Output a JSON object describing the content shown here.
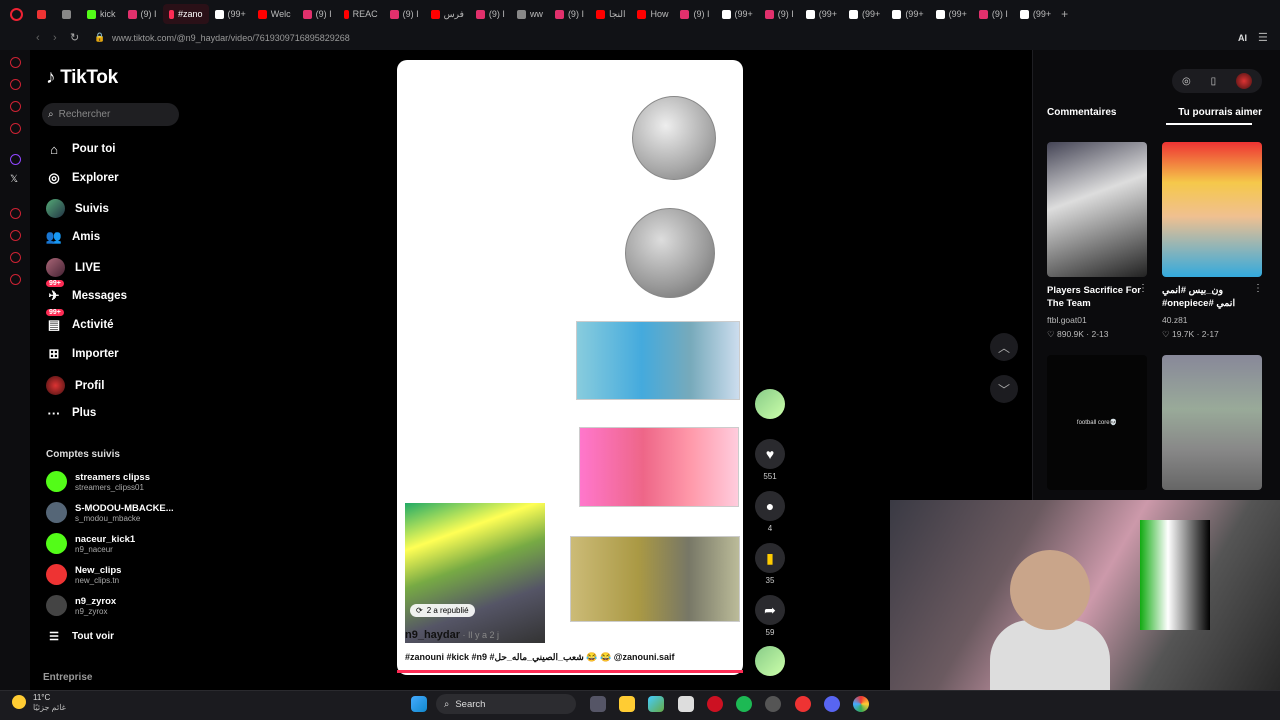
{
  "browser": {
    "tabs": [
      {
        "label": "",
        "color": "#e33"
      },
      {
        "label": "",
        "color": "#888"
      },
      {
        "label": "kick",
        "color": "#53fc18"
      },
      {
        "label": "(9) I",
        "color": "#e1306c"
      },
      {
        "label": "#zano",
        "color": "#fe2c55",
        "active": true
      },
      {
        "label": "(99+",
        "color": "#fff"
      },
      {
        "label": "Welc",
        "color": "#f00"
      },
      {
        "label": "(9) I",
        "color": "#e1306c"
      },
      {
        "label": "REAC",
        "color": "#f00"
      },
      {
        "label": "(9) I",
        "color": "#e1306c"
      },
      {
        "label": "فرس",
        "color": "#f00"
      },
      {
        "label": "(9) I",
        "color": "#e1306c"
      },
      {
        "label": "ww",
        "color": "#888"
      },
      {
        "label": "(9) I",
        "color": "#e1306c"
      },
      {
        "label": "النجا",
        "color": "#f00"
      },
      {
        "label": "How",
        "color": "#f00"
      },
      {
        "label": "(9) I",
        "color": "#e1306c"
      },
      {
        "label": "(99+",
        "color": "#fff"
      },
      {
        "label": "(9) I",
        "color": "#e1306c"
      },
      {
        "label": "(99+",
        "color": "#fff"
      },
      {
        "label": "(99+",
        "color": "#fff"
      },
      {
        "label": "(99+",
        "color": "#fff"
      },
      {
        "label": "(99+",
        "color": "#fff"
      },
      {
        "label": "(9) I",
        "color": "#e1306c"
      },
      {
        "label": "(99+",
        "color": "#fff"
      }
    ],
    "url": "www.tiktok.com/@n9_haydar/video/7619309716895829268",
    "ai_label": "AI"
  },
  "tiktok": {
    "logo": "TikTok",
    "search_placeholder": "Rechercher",
    "nav": {
      "for_you": "Pour toi",
      "explore": "Explorer",
      "following": "Suivis",
      "friends": "Amis",
      "live": "LIVE",
      "messages": "Messages",
      "activity": "Activité",
      "upload": "Importer",
      "profile": "Profil",
      "more": "Plus"
    },
    "badges": {
      "messages": "99+",
      "activity": "99+"
    },
    "followed_title": "Comptes suivis",
    "followed": [
      {
        "name": "streamers clipss",
        "handle": "streamers_clipss01",
        "color": "#53fc18"
      },
      {
        "name": "S-MODOU-MBACKE...",
        "handle": "s_modou_mbacke",
        "color": "#567"
      },
      {
        "name": "naceur_kick1",
        "handle": "n9_naceur",
        "color": "#53fc18"
      },
      {
        "name": "New_clips",
        "handle": "new_clips.tn",
        "color": "#e33"
      },
      {
        "name": "n9_zyrox",
        "handle": "n9_zyrox",
        "color": "#444"
      }
    ],
    "see_all": "Tout voir",
    "company": "Entreprise"
  },
  "video": {
    "repost": "2 a republié",
    "author": "n9_haydar",
    "time": " · Il y a 2 j",
    "caption": "#zanouni #kick #n9 #شعب_الصيني_ماله_حل 😂 😂 @zanouni.saif",
    "likes": "551",
    "comments": "4",
    "saves": "35",
    "shares": "59"
  },
  "right_panel": {
    "tab_comments": "Commentaires",
    "tab_related": "Tu pourrais aimer",
    "cards": [
      {
        "title": "Players Sacrifice For The Team",
        "author": "ftbl.goat01",
        "views": "890.9K",
        "date": "2-13"
      },
      {
        "title": "ون_بيس #انمي #onepiece# انمي",
        "author": "40.z81",
        "views": "19.7K",
        "date": "2-17"
      },
      {
        "overlay": "football core💀"
      }
    ]
  },
  "taskbar": {
    "temp": "11°C",
    "weather_text": "غائم جزئيًا",
    "search": "Search"
  }
}
